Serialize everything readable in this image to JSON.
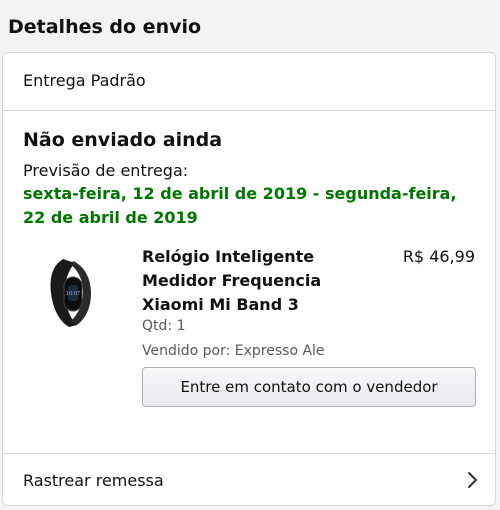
{
  "section": {
    "title": "Detalhes do envio"
  },
  "shipment": {
    "delivery_type": "Entrega Padrão",
    "status": "Não enviado ainda",
    "forecast_label": "Previsão de entrega:",
    "forecast_dates": "sexta-feira, 12 de abril de 2019 - segunda-feira, 22 de abril de 2019",
    "forecast_color": "#007600"
  },
  "product": {
    "image_icon": "smart-band-image",
    "title": "Relógio Inteligente Medidor Frequencia Xiaomi Mi Band 3",
    "price": "R$ 46,99",
    "quantity": "Qtd: 1",
    "seller": "Vendido por: Expresso Ale"
  },
  "actions": {
    "contact_seller": "Entre em contato com o vendedor",
    "track_shipment": "Rastrear remessa",
    "track_icon": "chevron-right-icon"
  }
}
